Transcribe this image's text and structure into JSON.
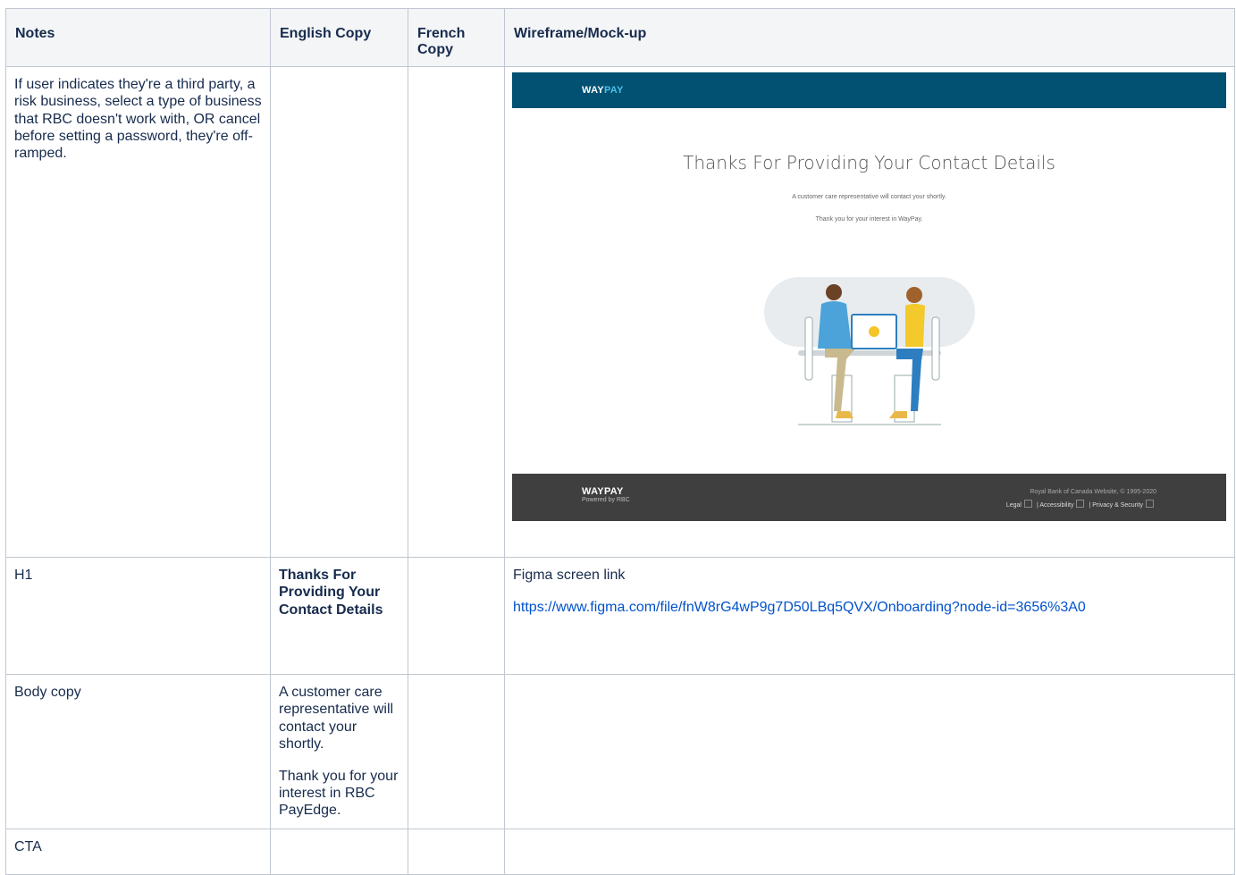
{
  "headers": {
    "notes": "Notes",
    "english": "English Copy",
    "french": "French Copy",
    "wireframe": "Wireframe/Mock-up"
  },
  "rows": {
    "mock": {
      "notes": "If user indicates they're a third party, a risk business, select a type of business that RBC doesn't work with, OR cancel before setting a password, they're off-ramped."
    },
    "h1": {
      "notes": "H1",
      "english": "Thanks For Providing Your Contact Details",
      "figma_label": "Figma screen link",
      "figma_url": "https://www.figma.com/file/fnW8rG4wP9g7D50LBq5QVX/Onboarding?node-id=3656%3A0"
    },
    "body": {
      "notes": "Body copy",
      "english_p1": "A customer care representative will contact your shortly.",
      "english_p2": "Thank you for your interest in RBC PayEdge."
    },
    "cta": {
      "notes": "CTA"
    }
  },
  "mockup": {
    "logo_way": "WAY",
    "logo_pay": "PAY",
    "title": "Thanks For Providing Your Contact Details",
    "line1": "A customer care representative will contact your shortly.",
    "line2": "Thank you for your interest in WayPay.",
    "footer_logo_way": "WAY",
    "footer_logo_pay": "PAY",
    "powered_by": "Powered by RBC",
    "copyright": "Royal Bank of Canada Website, © 1995-2020",
    "link_legal": "Legal",
    "link_accessibility": "Accessibility",
    "link_privacy": "Privacy & Security",
    "separator": "|",
    "colors": {
      "header": "#025072",
      "footer": "#3f3f3f",
      "logo_accent": "#4ac0e8"
    }
  }
}
